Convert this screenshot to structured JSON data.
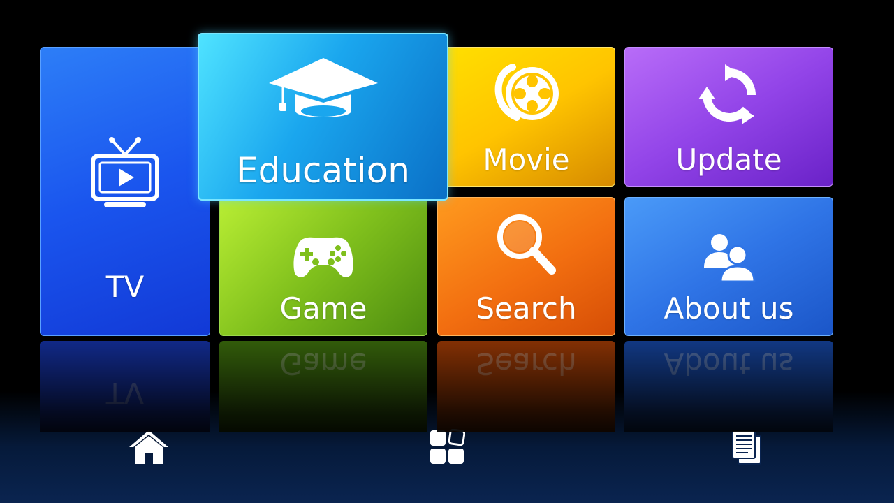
{
  "tiles": {
    "tv": {
      "label": "TV",
      "icon": "tv-play-icon",
      "color": "#1a55ee"
    },
    "education": {
      "label": "Education",
      "icon": "graduation-cap-icon",
      "color": "#1aa6ee"
    },
    "movie": {
      "label": "Movie",
      "icon": "film-reel-icon",
      "color": "#ffc400"
    },
    "update": {
      "label": "Update",
      "icon": "refresh-icon",
      "color": "#9244e8"
    },
    "game": {
      "label": "Game",
      "icon": "gamepad-icon",
      "color": "#7fbf1c"
    },
    "search": {
      "label": "Search",
      "icon": "magnifier-icon",
      "color": "#f26e10"
    },
    "about": {
      "label": "About us",
      "icon": "users-icon",
      "color": "#2f74e6"
    }
  },
  "selected_tile": "education",
  "nav": {
    "home": {
      "icon": "home-icon"
    },
    "apps": {
      "icon": "apps-grid-icon"
    },
    "documents": {
      "icon": "documents-icon"
    }
  }
}
